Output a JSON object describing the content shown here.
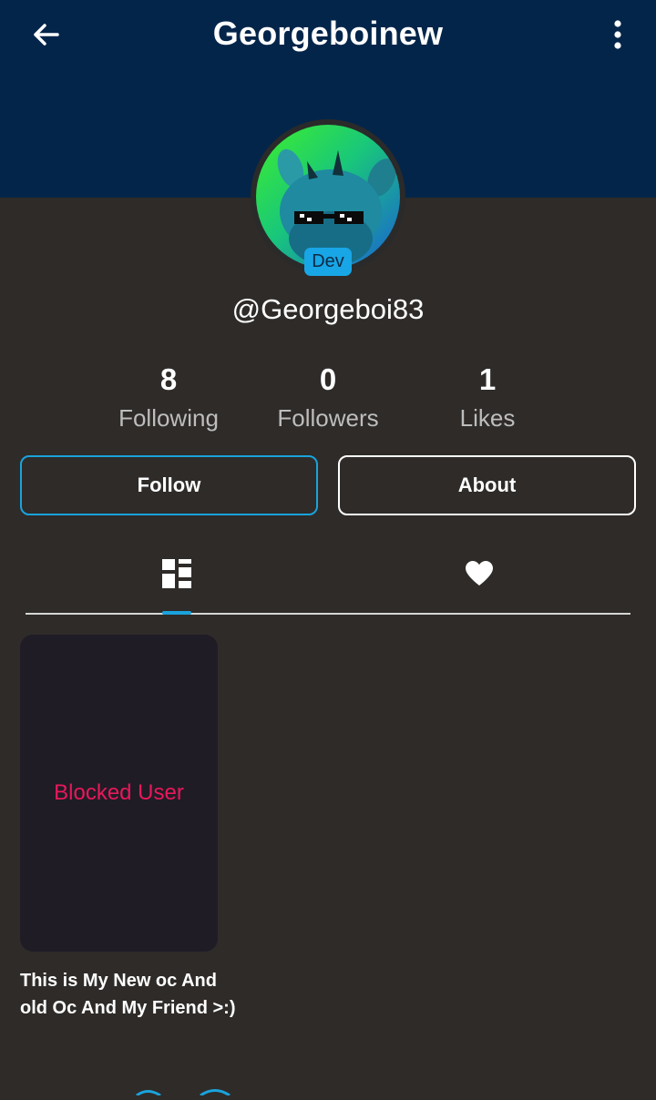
{
  "header": {
    "title": "Georgeboinew",
    "back_icon": "arrow-left-icon",
    "menu_icon": "more-vertical-icon",
    "background_color": "#04254a"
  },
  "profile": {
    "badge": "Dev",
    "handle": "@Georgeboi83",
    "stats": [
      {
        "value": "8",
        "label": "Following"
      },
      {
        "value": "0",
        "label": "Followers"
      },
      {
        "value": "1",
        "label": "Likes"
      }
    ]
  },
  "actions": {
    "follow_label": "Follow",
    "about_label": "About",
    "accent_color": "#1aa3dc"
  },
  "tabs": [
    {
      "icon": "grid-layout-icon",
      "active": true
    },
    {
      "icon": "heart-icon",
      "active": false
    }
  ],
  "posts": [
    {
      "card_text": "Blocked User",
      "caption": "This is My New oc And old Oc And My Friend >:)"
    }
  ]
}
